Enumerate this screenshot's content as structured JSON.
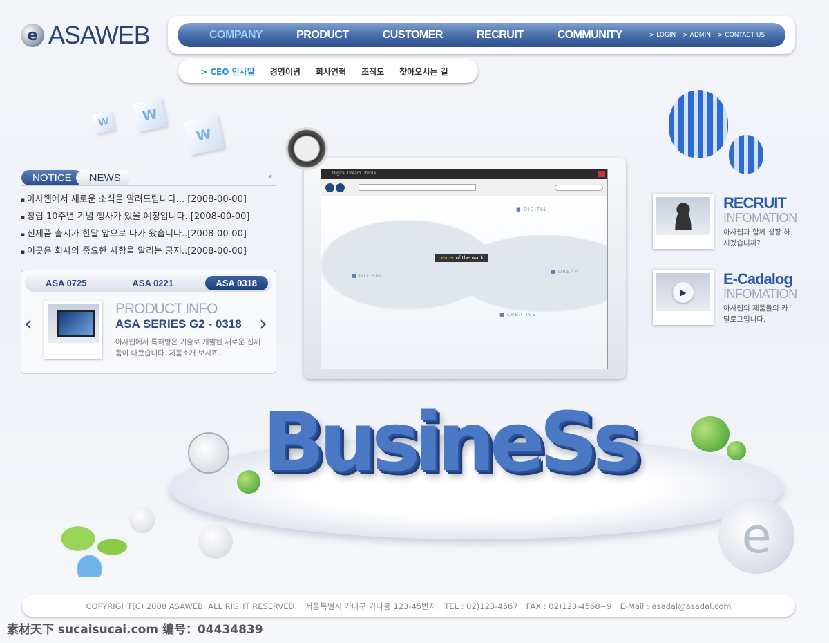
{
  "brand": {
    "name": "ASAWEB",
    "logo_letter": "e"
  },
  "nav": {
    "items": [
      {
        "label": "COMPANY",
        "active": true
      },
      {
        "label": "PRODUCT"
      },
      {
        "label": "CUSTOMER"
      },
      {
        "label": "RECRUIT"
      },
      {
        "label": "COMMUNITY"
      }
    ],
    "utility": [
      "> LOGIN",
      "> ADMIN",
      "> CONTACT US"
    ]
  },
  "subnav": {
    "items": [
      {
        "label": "> CEO 인사말",
        "active": true
      },
      {
        "label": "경영이념"
      },
      {
        "label": "회사연혁"
      },
      {
        "label": "조직도"
      },
      {
        "label": "찾아오시는 길"
      }
    ]
  },
  "notice": {
    "tabs": [
      "NOTICE",
      "NEWS"
    ],
    "more_icon": "double-chevron-right",
    "items": [
      "아사웹에서 새로운 소식을 알려드립니다... [2008-00-00]",
      "창립 10주년 기념 행사가 있을 예정입니다..[2008-00-00]",
      "신제품 출시가 한달 앞으로 다가 왔습니다..[2008-00-00]",
      "이곳은 회사의 중요한 사항을 알리는 공지..[2008-00-00]"
    ]
  },
  "product": {
    "tabs": [
      "ASA 0725",
      "ASA 0221",
      "ASA 0318"
    ],
    "active_tab": "ASA 0318",
    "title": "PRODUCT INFO",
    "subtitle": "ASA SERIES G2 - 0318",
    "desc": "아사웹에서 특허받은 기술로 개발된 새로운 신제품이 나왔습니다. 제품소개 보시죠.",
    "prev": "‹",
    "next": "›"
  },
  "hero": {
    "word": "BusineSs",
    "map_labels": {
      "digital": "DIGITAL",
      "global": "GLOBAL",
      "dream": "DREAM",
      "creative": "CREATIVE"
    },
    "callout_hl": "center",
    "callout_rest": " of the world",
    "window_title": "Digital Dream Utopia",
    "cube_letter": "W"
  },
  "recruit": {
    "title": "RECRUIT",
    "subtitle": "INFOMATION",
    "desc": "아사웹과 함께 성장 하시겠습니까?",
    "icon": "person-silhouette"
  },
  "ecatalog": {
    "title": "E-Cadalog",
    "subtitle": "INFOMATION",
    "desc": "아사웹의 제품들의 카달로그입니다.",
    "icon": "play"
  },
  "footer": {
    "copyright": "COPYRIGHT(C) 2008 ASAWEB.  ALL RIGHT RESERVED.",
    "address": "서울특별시 가나구 가나동 123-45번지",
    "tel": "TEL : 02)123-4567",
    "fax": "FAX : 02)123-4568~9",
    "email": "E-Mail : asadal@asadal.com"
  },
  "watermark": "素材天下 sucaisucai.com  编号：04434839",
  "colors": {
    "accent": "#2b4a86",
    "nav": "#3a5e9c",
    "active_sub": "#2a8fd8"
  }
}
